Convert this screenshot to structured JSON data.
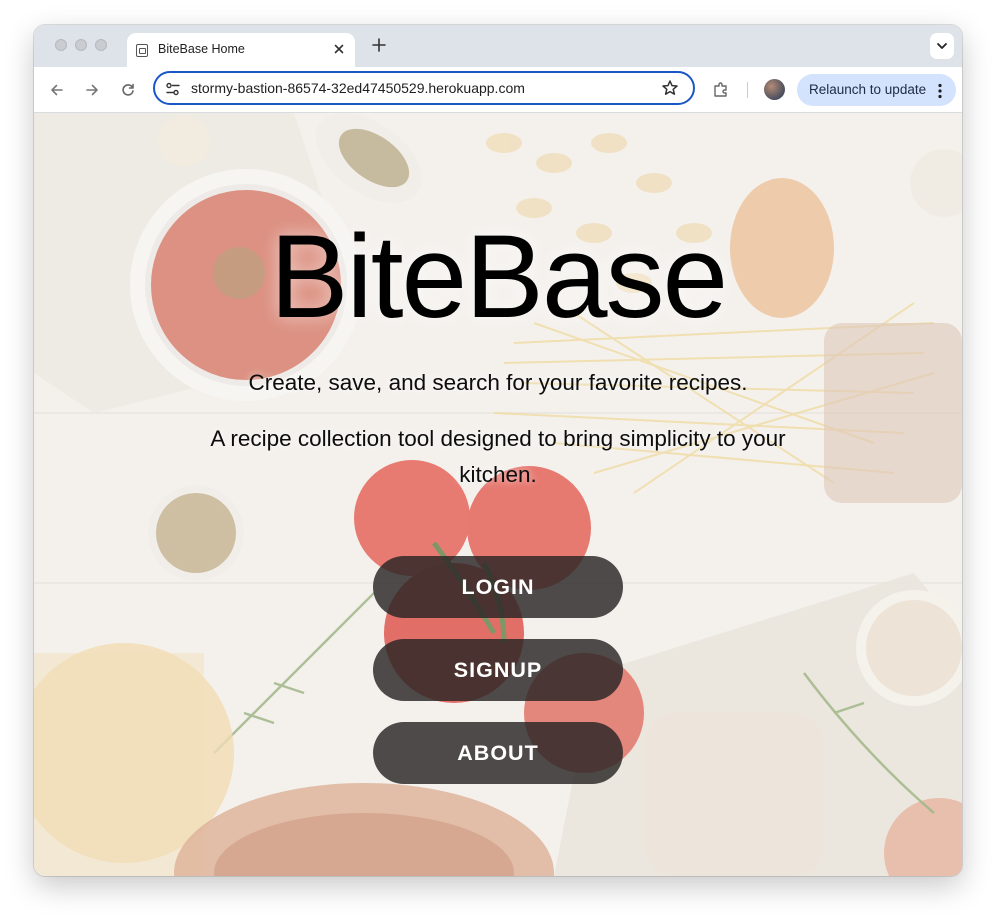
{
  "browser": {
    "tab_title": "BiteBase Home",
    "url": "stormy-bastion-86574-32ed47450529.herokuapp.com",
    "relaunch_label": "Relaunch to update",
    "icons": [
      "favicon-icon",
      "close-icon",
      "new-tab-icon",
      "tab-search-icon",
      "back-icon",
      "forward-icon",
      "reload-icon",
      "site-info-icon",
      "bookmark-star-icon",
      "extensions-icon",
      "profile-avatar",
      "more-menu-icon"
    ]
  },
  "hero": {
    "title": "BiteBase",
    "tagline": "Create, save, and search for your favorite recipes.",
    "description": "A recipe collection tool designed to bring simplicity to your kitchen."
  },
  "actions": {
    "login": "LOGIN",
    "signup": "SIGNUP",
    "about": "ABOUT"
  },
  "colors": {
    "button_bg": "#2b2626",
    "omnibox_border": "#1a56c4",
    "relaunch_bg": "#d3e3fd",
    "tab_strip_bg": "#dee3ea"
  }
}
